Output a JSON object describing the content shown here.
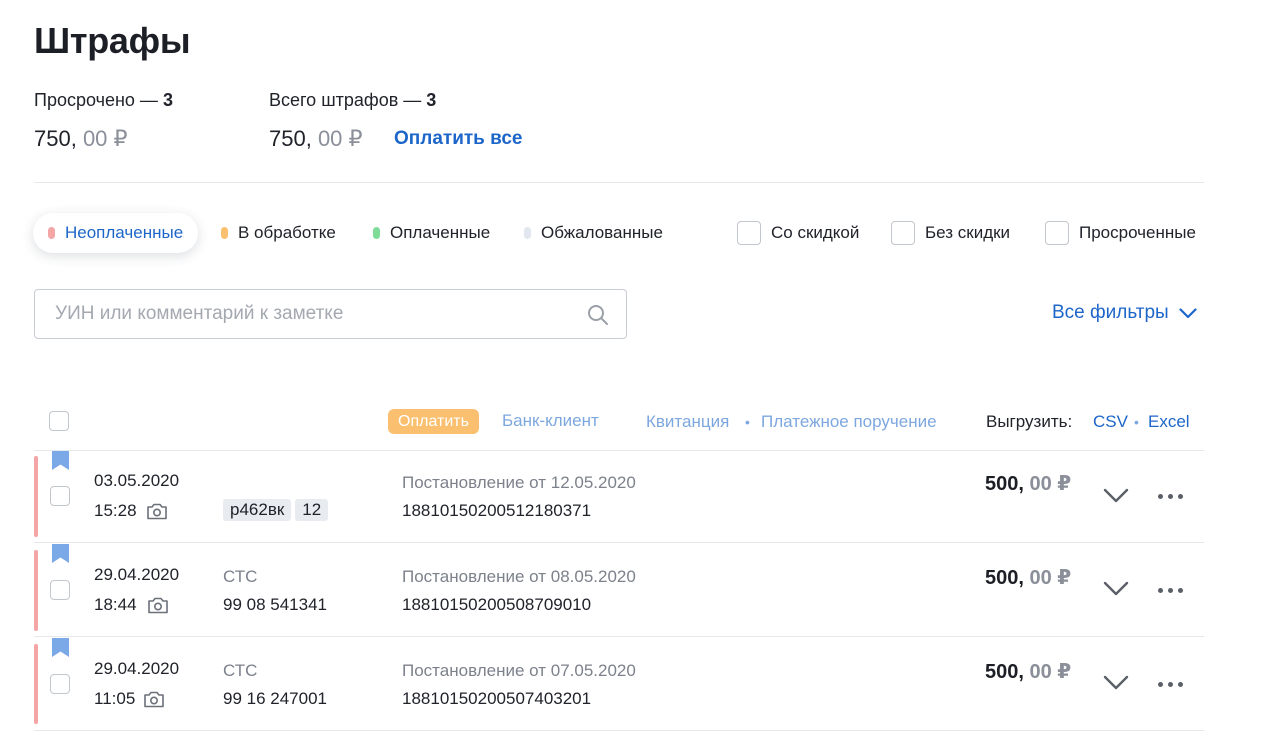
{
  "page": {
    "title": "Штрафы"
  },
  "summary": {
    "overdue_label": "Просрочено — ",
    "overdue_count": "3",
    "overdue_amount": "750, ",
    "overdue_kop": "00 ₽",
    "total_label": "Всего штрафов — ",
    "total_count": "3",
    "total_amount": "750, ",
    "total_kop": "00 ₽",
    "pay_all": "Оплатить все"
  },
  "status_tabs": [
    {
      "label": "Неоплаченные",
      "color": "#f4a5a5",
      "active": true
    },
    {
      "label": "В обработке",
      "color": "#fbc06f"
    },
    {
      "label": "Оплаченные",
      "color": "#7fdc98"
    },
    {
      "label": "Обжалованные",
      "color": "#e2e6ee"
    }
  ],
  "checks": [
    {
      "label": "Со скидкой"
    },
    {
      "label": "Без скидки"
    },
    {
      "label": "Просроченные"
    }
  ],
  "search": {
    "placeholder": "УИН или комментарий к заметке"
  },
  "all_filters": "Все фильтры",
  "toolbar": {
    "pay": "Оплатить",
    "bank_client": "Банк-клиент",
    "receipt": "Квитанция",
    "payment_order": "Платежное поручение",
    "export_label": "Выгрузить:",
    "csv": "CSV",
    "excel": "Excel",
    "sep": "•"
  },
  "fines": [
    {
      "date": "03.05.2020",
      "time": "15:28",
      "plate": "р462вк",
      "region": "12",
      "decree": "Постановление от 12.05.2020",
      "uin": "18810150200512180371",
      "amount": "500, ",
      "kop": "00 ₽"
    },
    {
      "date": "29.04.2020",
      "time": "18:44",
      "doc_type": "СТС",
      "doc_number": "99 08 541341",
      "decree": "Постановление от 08.05.2020",
      "uin": "18810150200508709010",
      "amount": "500, ",
      "kop": "00 ₽"
    },
    {
      "date": "29.04.2020",
      "time": "11:05",
      "doc_type": "СТС",
      "doc_number": "99 16 247001",
      "decree": "Постановление от 07.05.2020",
      "uin": "18810150200507403201",
      "amount": "500, ",
      "kop": "00 ₽"
    }
  ],
  "colors": {
    "accent": "#1d66c9",
    "overdue_flag": "#f4a5a5",
    "bookmark": "#7ba8e6",
    "pay_button": "#fbc06f"
  },
  "icons": {
    "camera": "camera-icon",
    "bookmark": "bookmark-icon",
    "search": "search-icon",
    "chevron": "chevron-down-icon",
    "more": "more-dots-icon"
  }
}
